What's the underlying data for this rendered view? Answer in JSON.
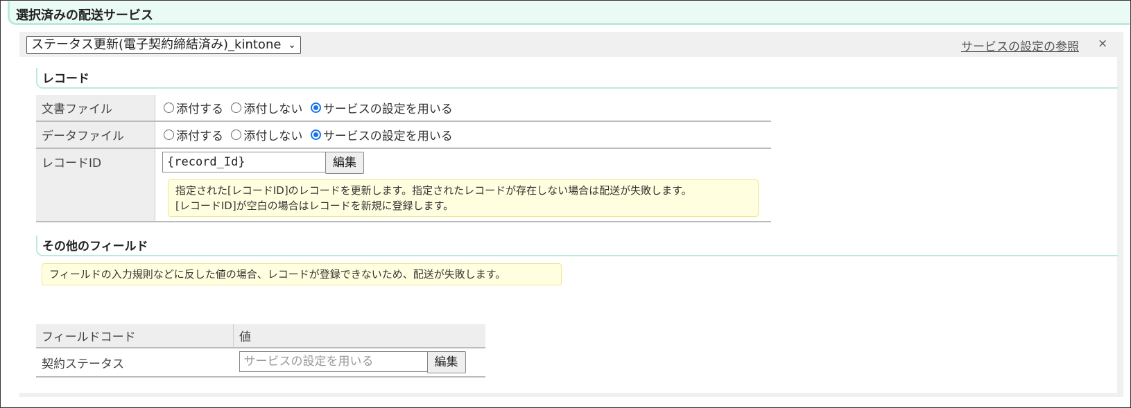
{
  "header": {
    "title": "選択済みの配送サービス"
  },
  "service": {
    "selected": "ステータス更新(電子契約締結済み)_kintone",
    "settings_link": "サービスの設定の参照",
    "close": "×"
  },
  "record_section": {
    "title": "レコード",
    "doc_file": {
      "label": "文書ファイル",
      "options": [
        "添付する",
        "添付しない",
        "サービスの設定を用いる"
      ],
      "selected_index": 2
    },
    "data_file": {
      "label": "データファイル",
      "options": [
        "添付する",
        "添付しない",
        "サービスの設定を用いる"
      ],
      "selected_index": 2
    },
    "record_id": {
      "label": "レコードID",
      "value": "{record_Id}",
      "edit_button": "編集",
      "note_line1": "指定された[レコードID]のレコードを更新します。指定されたレコードが存在しない場合は配送が失敗します。",
      "note_line2": "[レコードID]が空白の場合はレコードを新規に登録します。"
    }
  },
  "other_fields": {
    "title": "その他のフィールド",
    "note": "フィールドの入力規則などに反した値の場合、レコードが登録できないため、配送が失敗します。",
    "columns": [
      "フィールドコード",
      "値"
    ],
    "rows": [
      {
        "code": "契約ステータス",
        "placeholder": "サービスの設定を用いる",
        "edit_button": "編集"
      }
    ]
  }
}
